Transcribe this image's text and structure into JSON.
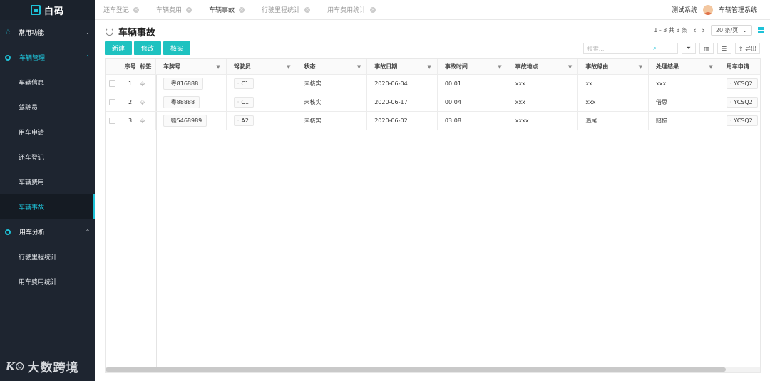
{
  "logo": {
    "text": "白码"
  },
  "sidebar": {
    "groups": [
      {
        "label": "常用功能",
        "icon": "star-icon",
        "expanded": false
      },
      {
        "label": "车辆管理",
        "icon": "circle-icon",
        "expanded": true,
        "items": [
          "车辆信息",
          "驾驶员",
          "用车申请",
          "还车登记",
          "车辆费用",
          "车辆事故"
        ]
      },
      {
        "label": "用车分析",
        "icon": "circle-icon",
        "expanded": true,
        "items": [
          "行驶里程统计",
          "用车费用统计"
        ]
      }
    ],
    "selected_item": "车辆事故"
  },
  "watermark": {
    "logo": "K☺",
    "text": "大数跨境"
  },
  "tabs": [
    {
      "label": "还车登记"
    },
    {
      "label": "车辆费用"
    },
    {
      "label": "车辆事故",
      "active": true
    },
    {
      "label": "行驶里程统计"
    },
    {
      "label": "用车费用统计"
    }
  ],
  "header_right": {
    "system": "测试系统",
    "app": "车辆管理系统"
  },
  "page": {
    "title": "车辆事故"
  },
  "pager": {
    "summary": "1 - 3  共  3  条",
    "page_size": "20 条/页"
  },
  "actions": {
    "new": "新建",
    "edit": "修改",
    "verify": "核实"
  },
  "search": {
    "placeholder": "搜索..."
  },
  "toolbar": {
    "export": "导出"
  },
  "table": {
    "columns": [
      "序号",
      "标签",
      "车牌号",
      "驾驶员",
      "状态",
      "事故日期",
      "事故时间",
      "事故地点",
      "事故缘由",
      "处理结果",
      "用车申请"
    ],
    "rows": [
      {
        "no": "1",
        "plate": "粤816888",
        "driver": "C1",
        "status": "未核实",
        "date": "2020-06-04",
        "time": "00:01",
        "place": "xxx",
        "reason": "xx",
        "result": "xxx",
        "apply": "YCSQ2"
      },
      {
        "no": "2",
        "plate": "粤88888",
        "driver": "C1",
        "status": "未核实",
        "date": "2020-06-17",
        "time": "00:04",
        "place": "xxx",
        "reason": "xxx",
        "result": "借思",
        "apply": "YCSQ2"
      },
      {
        "no": "3",
        "plate": "赣5468989",
        "driver": "A2",
        "status": "未核实",
        "date": "2020-06-02",
        "time": "03:08",
        "place": "xxxx",
        "reason": "追尾",
        "result": "赔偿",
        "apply": "YCSQ2"
      }
    ]
  },
  "colors": {
    "accent": "#1ec2d8",
    "button": "#1ec2c0",
    "sidebar_bg": "#1e2530"
  }
}
